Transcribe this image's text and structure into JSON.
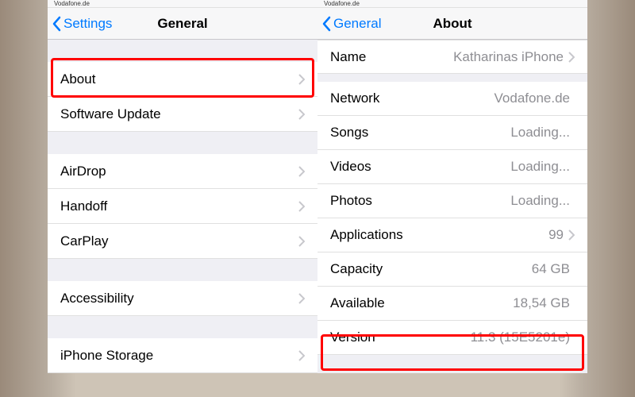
{
  "status": {
    "carrier": "Vodafone.de"
  },
  "left": {
    "back": "Settings",
    "title": "General",
    "rows": {
      "about": "About",
      "software_update": "Software Update",
      "airdrop": "AirDrop",
      "handoff": "Handoff",
      "carplay": "CarPlay",
      "accessibility": "Accessibility",
      "iphone_storage": "iPhone Storage"
    }
  },
  "right": {
    "back": "General",
    "title": "About",
    "rows": {
      "name": {
        "label": "Name",
        "value": "Katharinas iPhone"
      },
      "network": {
        "label": "Network",
        "value": "Vodafone.de"
      },
      "songs": {
        "label": "Songs",
        "value": "Loading..."
      },
      "videos": {
        "label": "Videos",
        "value": "Loading..."
      },
      "photos": {
        "label": "Photos",
        "value": "Loading..."
      },
      "applications": {
        "label": "Applications",
        "value": "99"
      },
      "capacity": {
        "label": "Capacity",
        "value": "64 GB"
      },
      "available": {
        "label": "Available",
        "value": "18,54 GB"
      },
      "version": {
        "label": "Version",
        "value": "11.3 (15E5201e)"
      }
    }
  }
}
